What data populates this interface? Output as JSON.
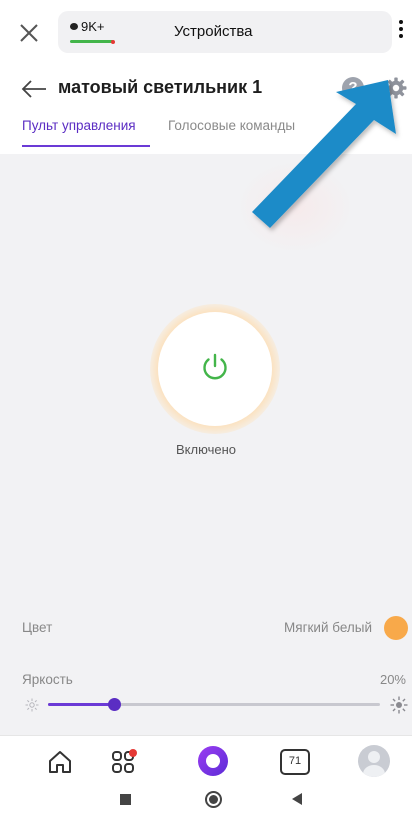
{
  "browser": {
    "badge_count": "9K+",
    "title": "Устройства"
  },
  "header": {
    "back_icon": "arrow-left-icon",
    "device_name": "матовый светильник 1",
    "help_symbol": "?",
    "settings_icon": "gear-icon",
    "tabs": [
      {
        "label": "Пульт управления",
        "active": true
      },
      {
        "label": "Голосовые команды",
        "active": false
      }
    ]
  },
  "control": {
    "power_icon": "power-icon",
    "status": "Включено",
    "color": {
      "label": "Цвет",
      "value": "Мягкий белый",
      "swatch": "#F8A94A"
    },
    "brightness": {
      "label": "Яркость",
      "value_text": "20%",
      "level_percent": 20
    }
  },
  "bottom_nav": {
    "items": [
      "home-icon",
      "apps-icon",
      "alice-icon",
      "calendar-icon",
      "profile-icon"
    ],
    "calendar_day": "71"
  },
  "colors": {
    "accent": "#6B3AD6",
    "power_green": "#43B54A",
    "annotation_arrow": "#1F8BC8"
  }
}
